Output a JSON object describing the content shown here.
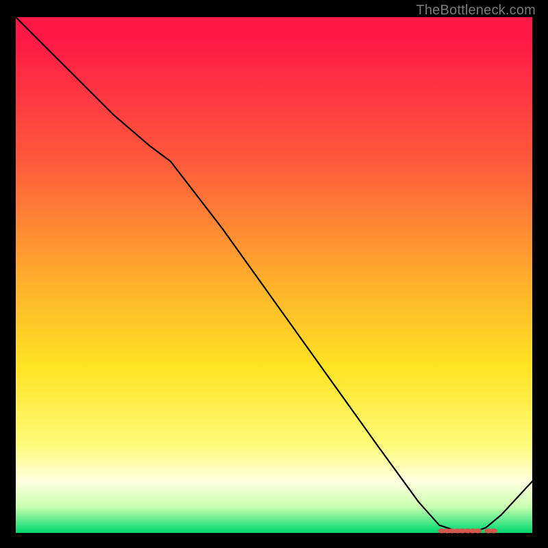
{
  "watermark": "TheBottleneck.com",
  "chart_data": {
    "type": "line",
    "title": "",
    "xlabel": "",
    "ylabel": "",
    "xlim": [
      0,
      1
    ],
    "ylim": [
      0,
      1
    ],
    "series": [
      {
        "name": "curve",
        "x": [
          0.0,
          0.06,
          0.12,
          0.19,
          0.26,
          0.3,
          0.4,
          0.5,
          0.6,
          0.7,
          0.78,
          0.82,
          0.85,
          0.88,
          0.91,
          0.94,
          1.0
        ],
        "y": [
          1.0,
          0.94,
          0.88,
          0.81,
          0.75,
          0.72,
          0.59,
          0.45,
          0.31,
          0.17,
          0.06,
          0.015,
          0.005,
          0.0,
          0.01,
          0.035,
          0.1
        ]
      }
    ],
    "bottom_markers_x": [
      0.825,
      0.835,
      0.845,
      0.855,
      0.865,
      0.875,
      0.885,
      0.895,
      0.915,
      0.925
    ]
  }
}
